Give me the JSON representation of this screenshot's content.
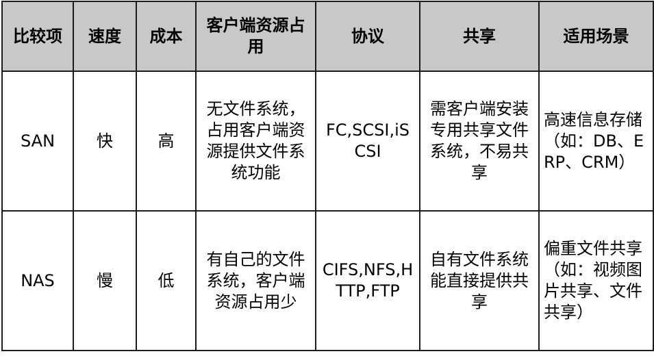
{
  "table": {
    "headers": [
      "比较项",
      "速度",
      "成本",
      "客户端资源占用",
      "协议",
      "共享",
      "适用场景"
    ],
    "rows": [
      {
        "item": "SAN",
        "speed": "快",
        "cost": "高",
        "client_resource": "无文件系统，占用客户端资源提供文件系统功能",
        "protocol": "FC,SCSI,iSCSI",
        "sharing": "需客户端安装专用共享文件系统，不易共享",
        "scenario": "高速信息存储（如：DB、ERP、CRM）"
      },
      {
        "item": "NAS",
        "speed": "慢",
        "cost": "低",
        "client_resource": "有自己的文件系统，客户端资源占用少",
        "protocol": "CIFS,NFS,HTTP,FTP",
        "sharing": "自有文件系统能直接提供共享",
        "scenario": "偏重文件共享（如：视频图片共享、文件共享）"
      }
    ]
  }
}
